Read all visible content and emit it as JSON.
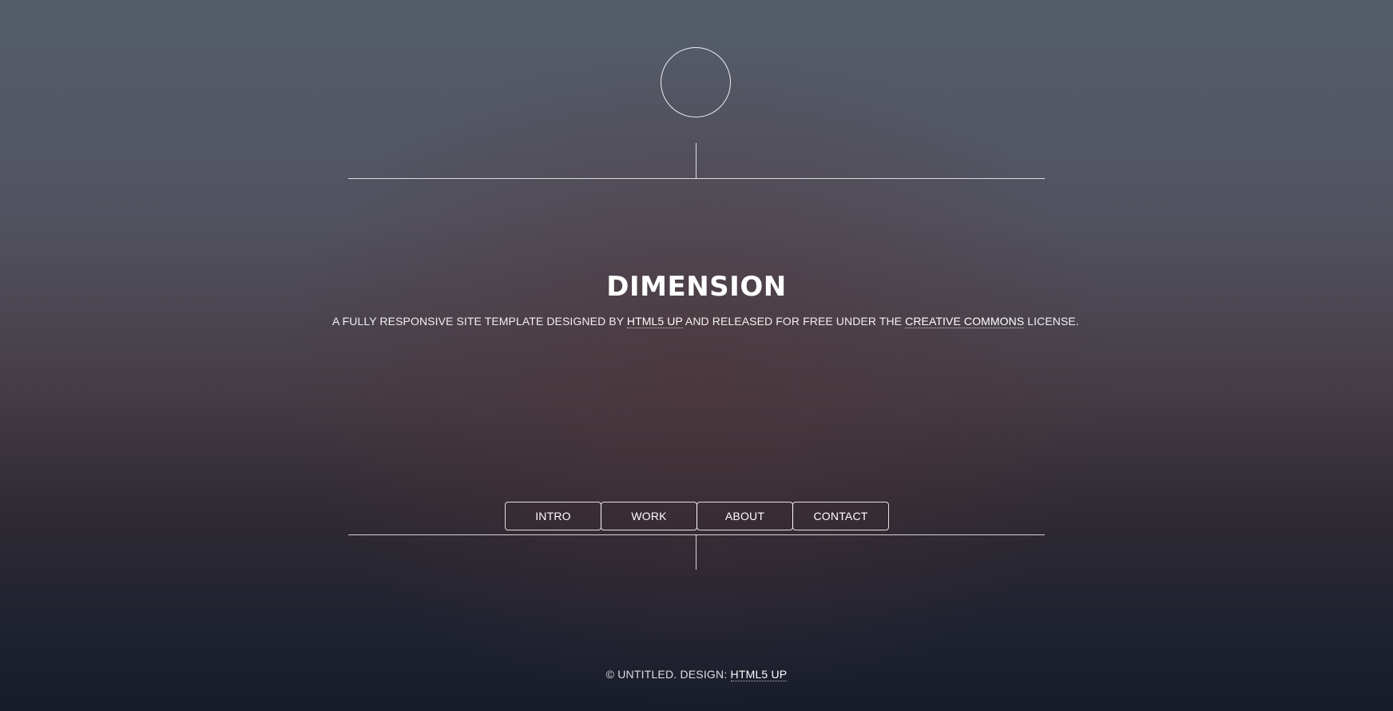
{
  "header": {
    "logo_icon": "circle-logo-icon"
  },
  "content": {
    "title": "DIMENSION",
    "subtitle_before": "A FULLY RESPONSIVE SITE TEMPLATE DESIGNED BY ",
    "subtitle_link1": "HTML5 UP",
    "subtitle_middle": " AND RELEASED FOR FREE UNDER THE ",
    "subtitle_link2": "CREATIVE COMMONS",
    "subtitle_after": " LICENSE."
  },
  "nav": {
    "items": [
      {
        "label": "INTRO"
      },
      {
        "label": "WORK"
      },
      {
        "label": "ABOUT"
      },
      {
        "label": "CONTACT"
      }
    ]
  },
  "footer": {
    "copyright": "© UNTITLED. DESIGN: ",
    "design_link": "HTML5 UP"
  },
  "colors": {
    "text": "#ffffff",
    "background_top": "#555d6b",
    "background_bottom": "#171c29"
  }
}
